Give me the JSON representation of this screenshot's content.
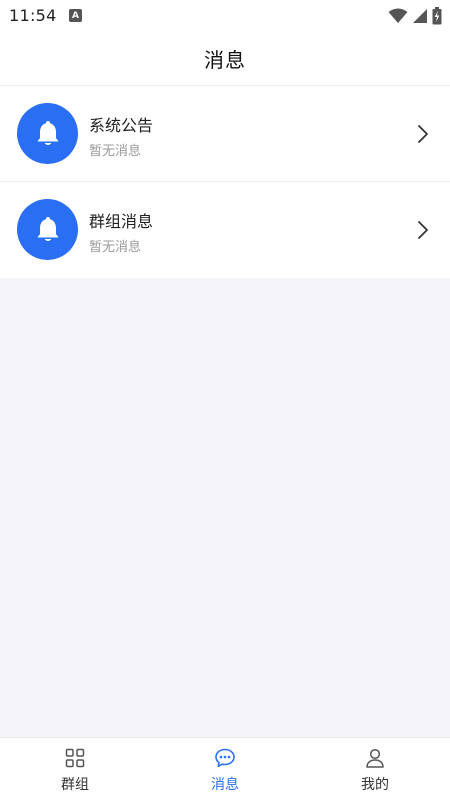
{
  "status_bar": {
    "time": "11:54",
    "notification_glyph": "A"
  },
  "header": {
    "title": "消息"
  },
  "messages": [
    {
      "title": "系统公告",
      "subtitle": "暂无消息",
      "icon": "bell-icon"
    },
    {
      "title": "群组消息",
      "subtitle": "暂无消息",
      "icon": "bell-icon"
    }
  ],
  "tabbar": {
    "tabs": [
      {
        "label": "群组",
        "icon": "grid-icon",
        "active": false
      },
      {
        "label": "消息",
        "icon": "chat-bubble-icon",
        "active": true
      },
      {
        "label": "我的",
        "icon": "person-icon",
        "active": false
      }
    ]
  },
  "colors": {
    "accent": "#2a6ff3",
    "background": "#f5f5f9"
  }
}
